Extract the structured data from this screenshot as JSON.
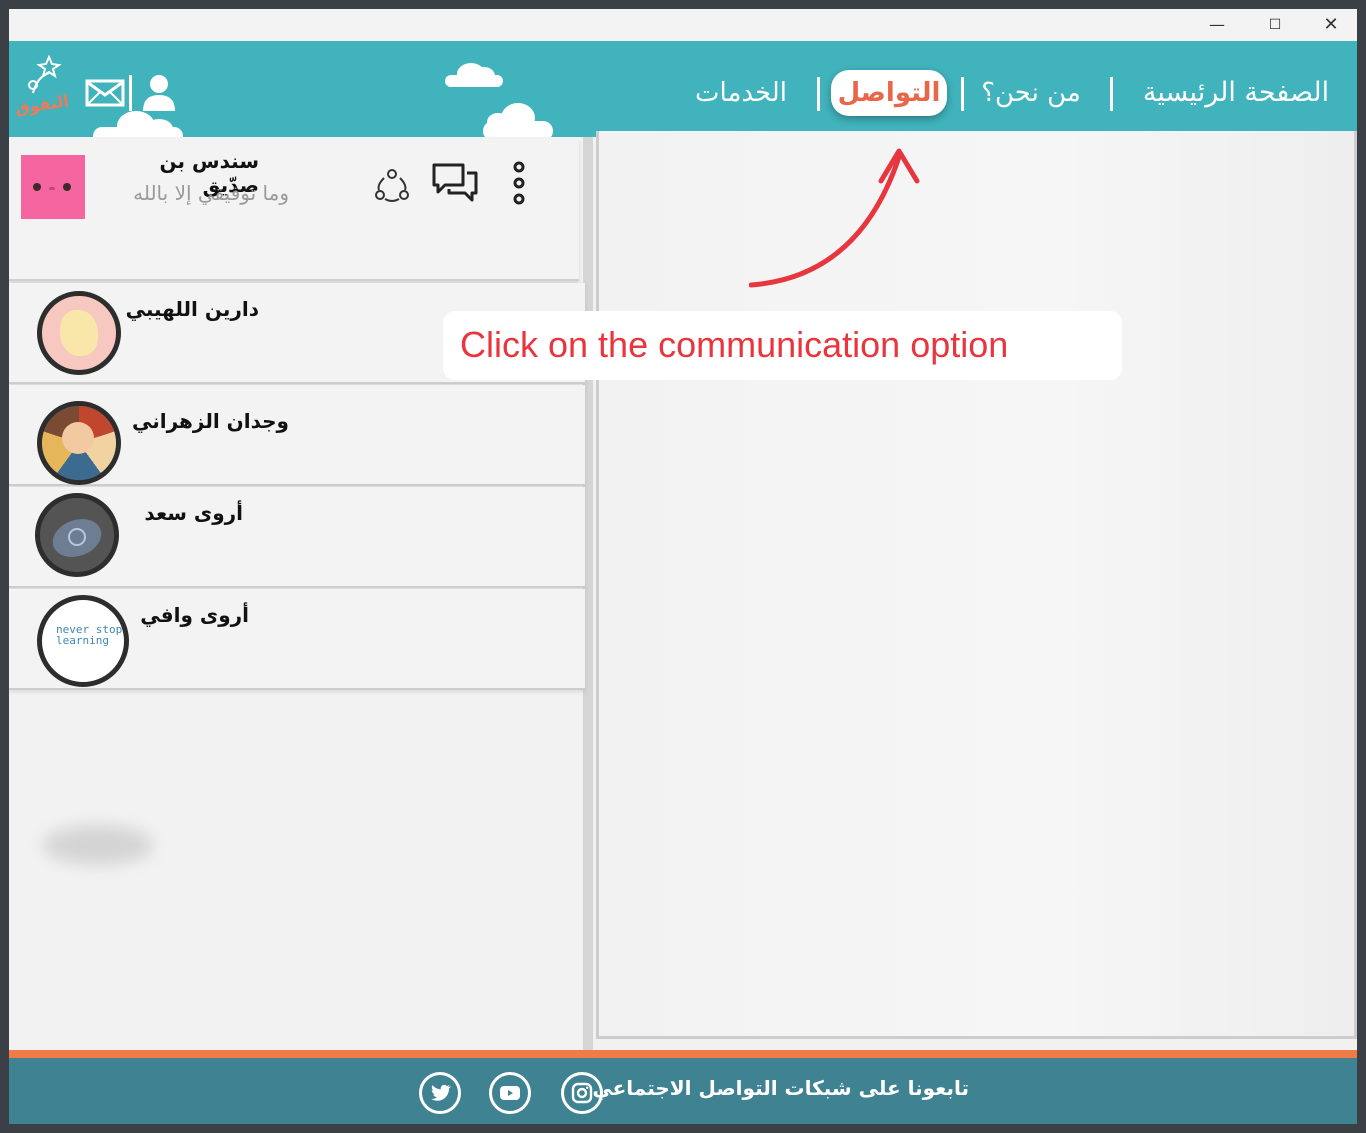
{
  "window": {
    "minimize": "—",
    "maximize": "☐",
    "close": "✕"
  },
  "header": {
    "logo_text": "التفوق",
    "nav": {
      "home": "الصفحة الرئيسية",
      "about": "من نحن؟",
      "contact": "التواصل",
      "services": "الخدمات"
    },
    "icons": [
      "user-icon",
      "mail-icon",
      "logo-icon"
    ]
  },
  "profile": {
    "name": "سندس بن صدّيق",
    "status": "وما توفيقي إلا بالله",
    "icons": [
      "share-icon",
      "chat-icon",
      "more-vertical-icon"
    ]
  },
  "contacts": [
    {
      "name": "دارين اللهيبي"
    },
    {
      "name": "وجدان الزهراني"
    },
    {
      "name": "أروى سعد"
    },
    {
      "name": "أروى وافي",
      "avatar_text": "never stop learning"
    }
  ],
  "footer": {
    "text": "تابعونا على شبكات التواصل الاجتماعي",
    "icons": [
      "instagram-icon",
      "youtube-icon",
      "twitter-icon"
    ]
  },
  "annotation": {
    "text": "Click on the communication option",
    "color": "#e8363f"
  },
  "colors": {
    "header": "#40b3bc",
    "accent": "#e8664a",
    "footer": "#3f8392",
    "footer_line": "#f07b46"
  }
}
